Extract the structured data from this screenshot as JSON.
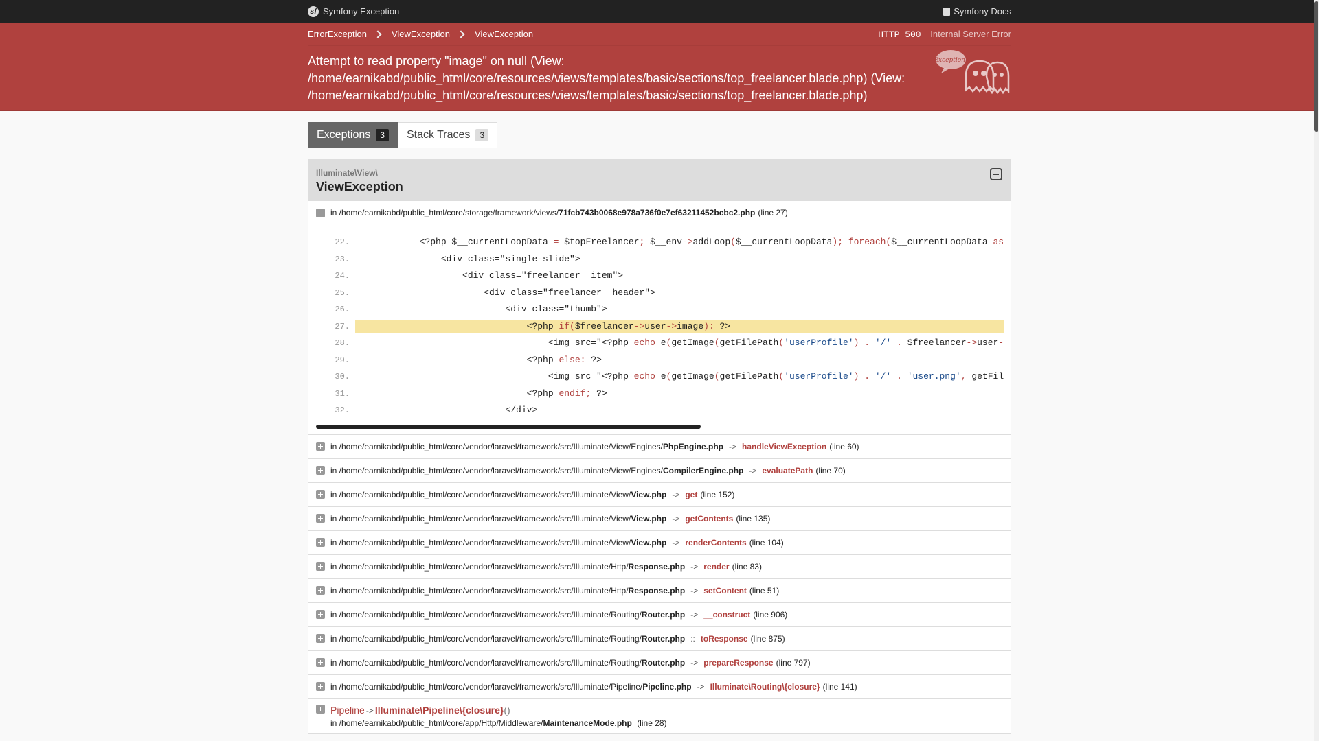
{
  "topbar": {
    "brand": "Symfony Exception",
    "docs": "Symfony Docs"
  },
  "breadcrumbs": [
    "ErrorException",
    "ViewException",
    "ViewException"
  ],
  "status": {
    "code": "HTTP 500",
    "text": "Internal Server Error"
  },
  "message": "Attempt to read property \"image\" on null (View: /home/earnikabd/public_html/core/resources/views/templates/basic/sections/top_freelancer.blade.php) (View: /home/earnikabd/public_html/core/resources/views/templates/basic/sections/top_freelancer.blade.php)",
  "ghost_text": "Exception!",
  "tabs": [
    {
      "label": "Exceptions",
      "count": "3"
    },
    {
      "label": "Stack Traces",
      "count": "3"
    }
  ],
  "exception": {
    "namespace": "Illuminate\\View\\",
    "class": "ViewException",
    "first_trace": {
      "prefix": "in /home/earnikabd/public_html/core/storage/framework/views/",
      "file": "71fcb743b0068e978a736f0e7ef63211452bcbc2.php",
      "line": "(line 27)"
    }
  },
  "code_lines": [
    {
      "n": "22."
    },
    {
      "n": "23."
    },
    {
      "n": "24."
    },
    {
      "n": "25."
    },
    {
      "n": "26."
    },
    {
      "n": "27."
    },
    {
      "n": "28."
    },
    {
      "n": "29."
    },
    {
      "n": "30."
    },
    {
      "n": "31."
    },
    {
      "n": "32."
    }
  ],
  "traces": [
    {
      "prefix": "in /home/earnikabd/public_html/core/vendor/laravel/framework/src/Illuminate/View/Engines/",
      "file": "PhpEngine.php",
      "arrow": "->",
      "func": "handleViewException",
      "line": "(line 60)"
    },
    {
      "prefix": "in /home/earnikabd/public_html/core/vendor/laravel/framework/src/Illuminate/View/Engines/",
      "file": "CompilerEngine.php",
      "arrow": "->",
      "func": "evaluatePath",
      "line": "(line 70)"
    },
    {
      "prefix": "in /home/earnikabd/public_html/core/vendor/laravel/framework/src/Illuminate/View/",
      "file": "View.php",
      "arrow": "->",
      "func": "get",
      "line": "(line 152)"
    },
    {
      "prefix": "in /home/earnikabd/public_html/core/vendor/laravel/framework/src/Illuminate/View/",
      "file": "View.php",
      "arrow": "->",
      "func": "getContents",
      "line": "(line 135)"
    },
    {
      "prefix": "in /home/earnikabd/public_html/core/vendor/laravel/framework/src/Illuminate/View/",
      "file": "View.php",
      "arrow": "->",
      "func": "renderContents",
      "line": "(line 104)"
    },
    {
      "prefix": "in /home/earnikabd/public_html/core/vendor/laravel/framework/src/Illuminate/Http/",
      "file": "Response.php",
      "arrow": "->",
      "func": "render",
      "line": "(line 83)"
    },
    {
      "prefix": "in /home/earnikabd/public_html/core/vendor/laravel/framework/src/Illuminate/Http/",
      "file": "Response.php",
      "arrow": "->",
      "func": "setContent",
      "line": "(line 51)"
    },
    {
      "prefix": "in /home/earnikabd/public_html/core/vendor/laravel/framework/src/Illuminate/Routing/",
      "file": "Router.php",
      "arrow": "->",
      "func": "__construct",
      "line": "(line 906)"
    },
    {
      "prefix": "in /home/earnikabd/public_html/core/vendor/laravel/framework/src/Illuminate/Routing/",
      "file": "Router.php",
      "arrow": "::",
      "func": "toResponse",
      "line": "(line 875)"
    },
    {
      "prefix": "in /home/earnikabd/public_html/core/vendor/laravel/framework/src/Illuminate/Routing/",
      "file": "Router.php",
      "arrow": "->",
      "func": "prepareResponse",
      "line": "(line 797)"
    },
    {
      "prefix": "in /home/earnikabd/public_html/core/vendor/laravel/framework/src/Illuminate/Pipeline/",
      "file": "Pipeline.php",
      "arrow": "->",
      "func": "Illuminate\\Routing\\{closure}",
      "line": "(line 141)"
    }
  ],
  "last_trace": {
    "class": "Pipeline",
    "arrow": "->",
    "func": "Illuminate\\Pipeline\\{closure}",
    "parens": "()",
    "prefix": "in /home/earnikabd/public_html/core/app/Http/Middleware/",
    "file": "MaintenanceMode.php",
    "line": "(line 28)"
  },
  "colors": {
    "accent": "#b0413e",
    "topbar": "#222222",
    "highlight": "#f7e5a1"
  }
}
